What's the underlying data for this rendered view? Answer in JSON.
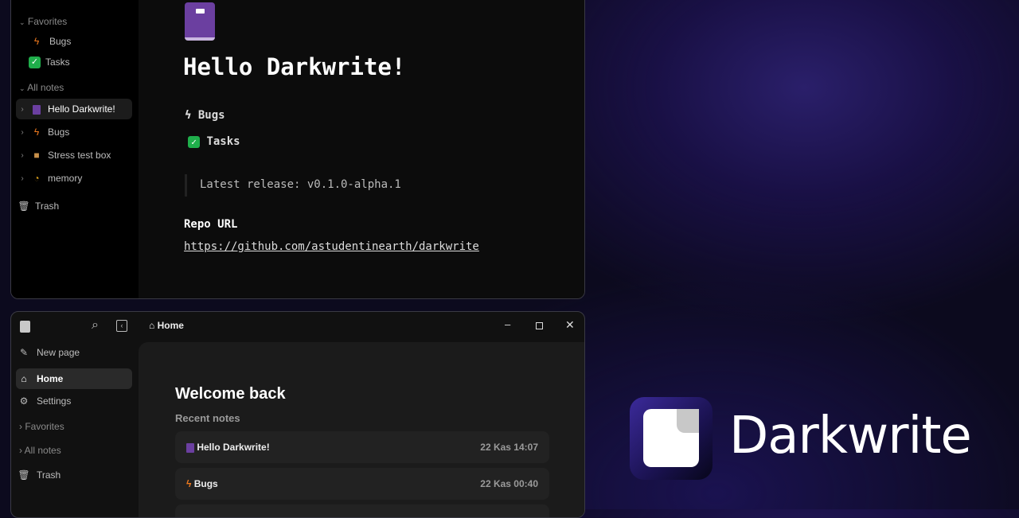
{
  "top_window": {
    "sidebar": {
      "favorites_label": "Favorites",
      "favorites": [
        {
          "icon": "lightning-icon",
          "label": "Bugs"
        },
        {
          "icon": "checkbox-icon",
          "label": "Tasks"
        }
      ],
      "all_notes_label": "All notes",
      "notes": [
        {
          "icon": "book-icon",
          "label": "Hello Darkwrite!"
        },
        {
          "icon": "lightning-icon",
          "label": "Bugs"
        },
        {
          "icon": "package-icon",
          "label": "Stress test box"
        },
        {
          "icon": "memory-icon",
          "label": "memory"
        }
      ],
      "trash_label": "Trash"
    },
    "doc": {
      "title": "Hello Darkwrite!",
      "link1": "Bugs",
      "link2": "Tasks",
      "quote": "Latest release: v0.1.0-alpha.1",
      "repo_heading": "Repo URL",
      "repo_url": "https://github.com/astudentinearth/darkwrite"
    }
  },
  "bottom_window": {
    "breadcrumb": "Home",
    "sidebar": {
      "new_page": "New page",
      "home": "Home",
      "settings": "Settings",
      "favorites": "Favorites",
      "all_notes": "All notes",
      "trash": "Trash"
    },
    "welcome": "Welcome back",
    "recent_label": "Recent notes",
    "recent": [
      {
        "icon": "book-icon",
        "title": "Hello Darkwrite!",
        "date": "22 Kas 14:07"
      },
      {
        "icon": "lightning-icon",
        "title": "Bugs",
        "date": "22 Kas 00:40"
      }
    ]
  },
  "brand": {
    "name": "Darkwrite"
  },
  "colors": {
    "accent": "#3b2a9a",
    "bolt": "#f07a1e",
    "check": "#1fae4b",
    "book": "#6b3fa0"
  }
}
